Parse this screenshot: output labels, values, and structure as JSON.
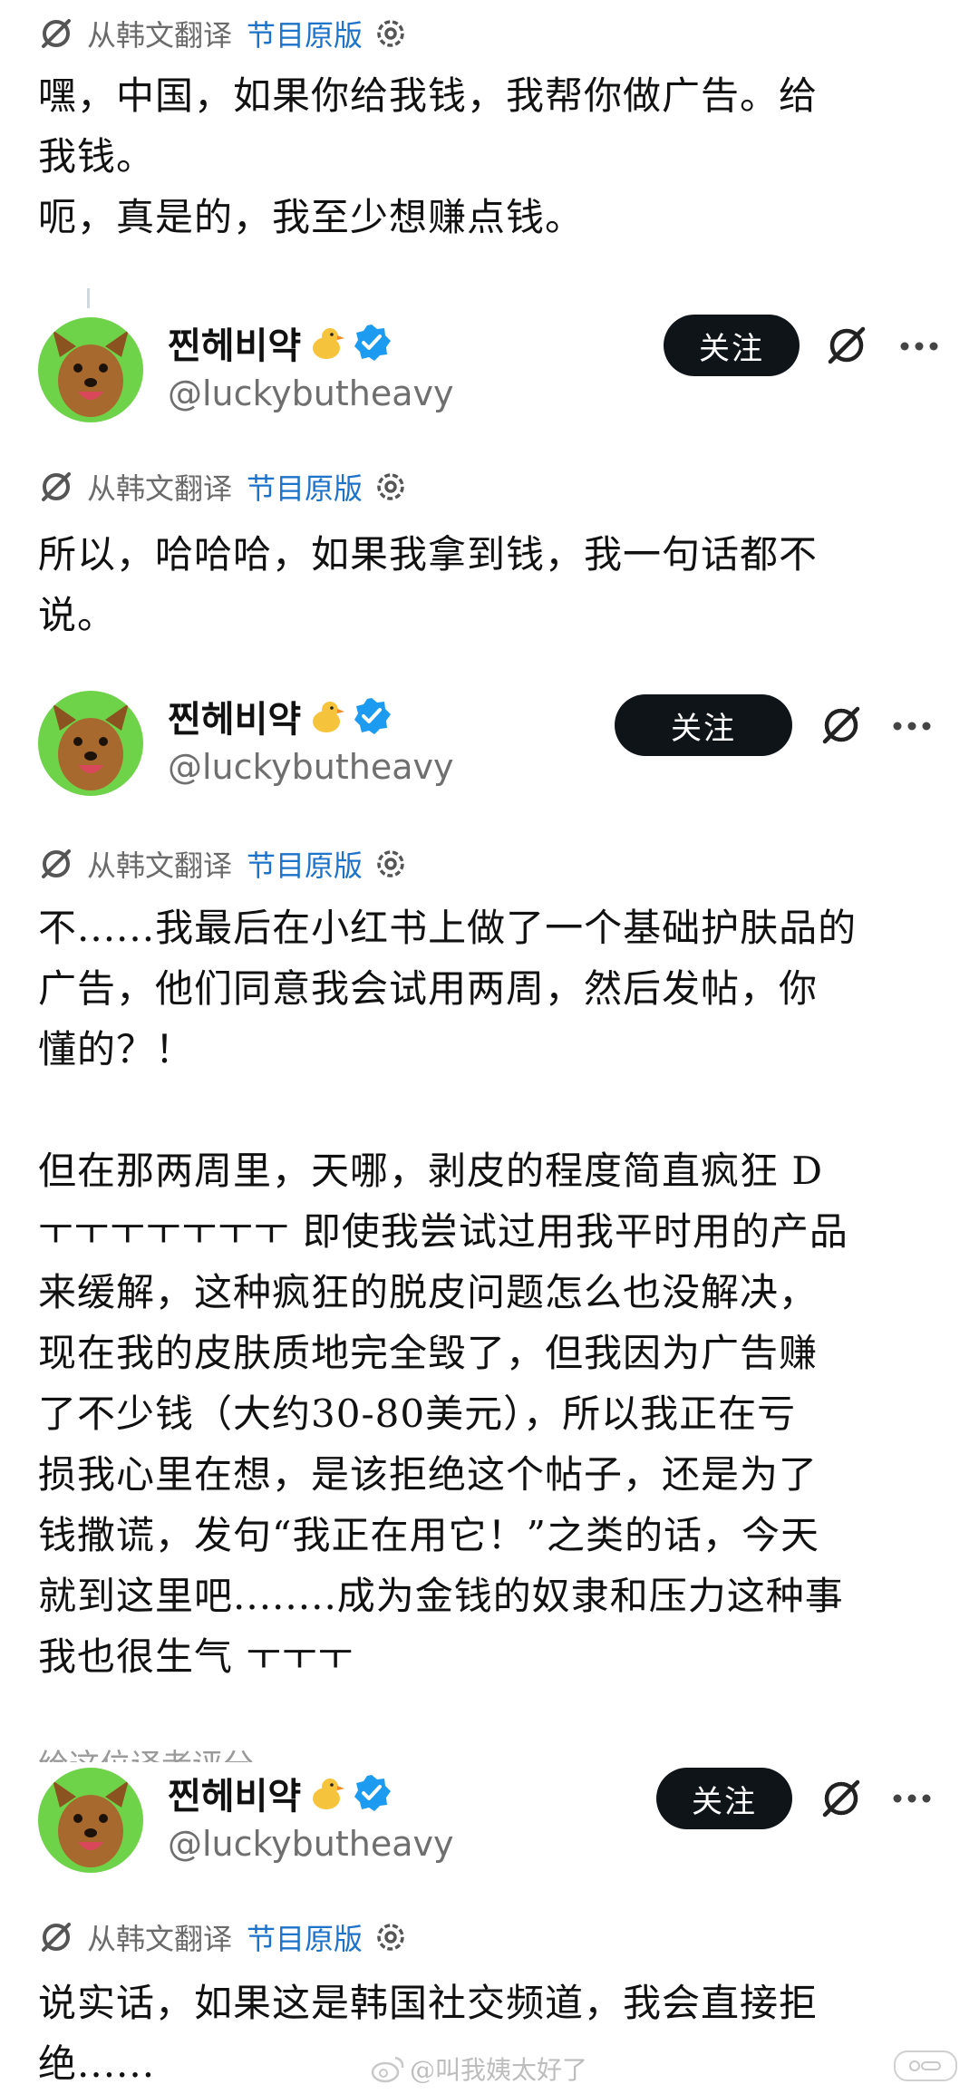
{
  "translation": {
    "label": "从韩文翻译",
    "link": "节目原版"
  },
  "user": {
    "display_name": "찐헤비약",
    "handle": "@luckybutheavy",
    "follow_label": "关注"
  },
  "posts": [
    {
      "lines": [
        "嘿，中国，如果你给我钱，我帮你做广告。给",
        "我钱。",
        "呃，真是的，我至少想赚点钱。"
      ]
    },
    {
      "lines": [
        "所以，哈哈哈，如果我拿到钱，我一句话都不",
        "说。"
      ]
    },
    {
      "lines": [
        "不......我最后在小红书上做了一个基础护肤品的",
        "广告，他们同意我会试用两周，然后发帖，你",
        "懂的？！",
        "",
        "但在那两周里，天哪，剥皮的程度简直疯狂 D",
        "ㅜㅜㅜㅜㅜㅜㅜ 即使我尝试过用我平时用的产品",
        "来缓解，这种疯狂的脱皮问题怎么也没解决，",
        "现在我的皮肤质地完全毁了，但我因为广告赚",
        "了不少钱（大约30-80美元），所以我正在亏",
        "损我心里在想，是该拒绝这个帖子，还是为了",
        "钱撒谎，发句“我正在用它！”之类的话，今天",
        "就到这里吧........成为金钱的奴隶和压力这种事",
        "我也很生气 ㅜㅜㅜ"
      ]
    },
    {
      "lines": [
        "说实话，如果这是韩国社交频道，我会直接拒",
        "绝......"
      ]
    }
  ],
  "ghost_text": "给这位译者评分",
  "watermark": {
    "text": "@叫我姨太好了"
  },
  "colors": {
    "link": "#1d72c9",
    "follow_bg": "#0f1419",
    "verified": "#1d9bf0",
    "avatar_bg": "#6fd34a"
  }
}
